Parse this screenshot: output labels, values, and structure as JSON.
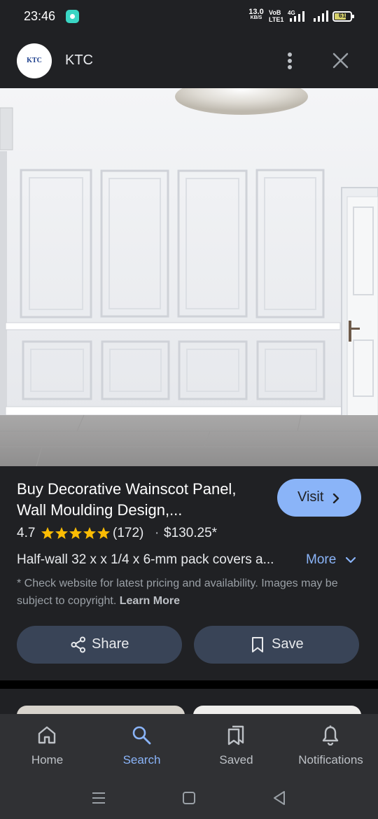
{
  "status_bar": {
    "time": "23:46",
    "net_speed": "13.0",
    "net_speed_unit": "KB/S",
    "volte": "VoB LTE1",
    "network": "4G",
    "battery": "61"
  },
  "header": {
    "logo_text": "KTC",
    "site_name": "KTC"
  },
  "product": {
    "title": "Buy Decorative Wainscot Panel, Wall Moulding Design,...",
    "visit_label": "Visit",
    "rating": "4.7",
    "star_rating": 4.7,
    "review_count": "(172)",
    "separator": "·",
    "price": "$130.25*",
    "description": "Half-wall 32 x x 1/4 x 6-mm pack covers a...",
    "more_label": "More",
    "disclaimer": "* Check website for latest pricing and availability. Images may be subject to copyright.",
    "learn_more_label": "Learn More",
    "share_label": "Share",
    "save_label": "Save"
  },
  "bottom_nav": {
    "items": [
      {
        "label": "Home",
        "icon": "home-icon",
        "active": false
      },
      {
        "label": "Search",
        "icon": "search-icon",
        "active": true
      },
      {
        "label": "Saved",
        "icon": "saved-icon",
        "active": false
      },
      {
        "label": "Notifications",
        "icon": "bell-icon",
        "active": false
      }
    ]
  },
  "colors": {
    "background": "#202124",
    "accent": "#8ab4f8",
    "pill_button": "#394457",
    "nav_background": "#303134",
    "star": "#fbbc04"
  }
}
